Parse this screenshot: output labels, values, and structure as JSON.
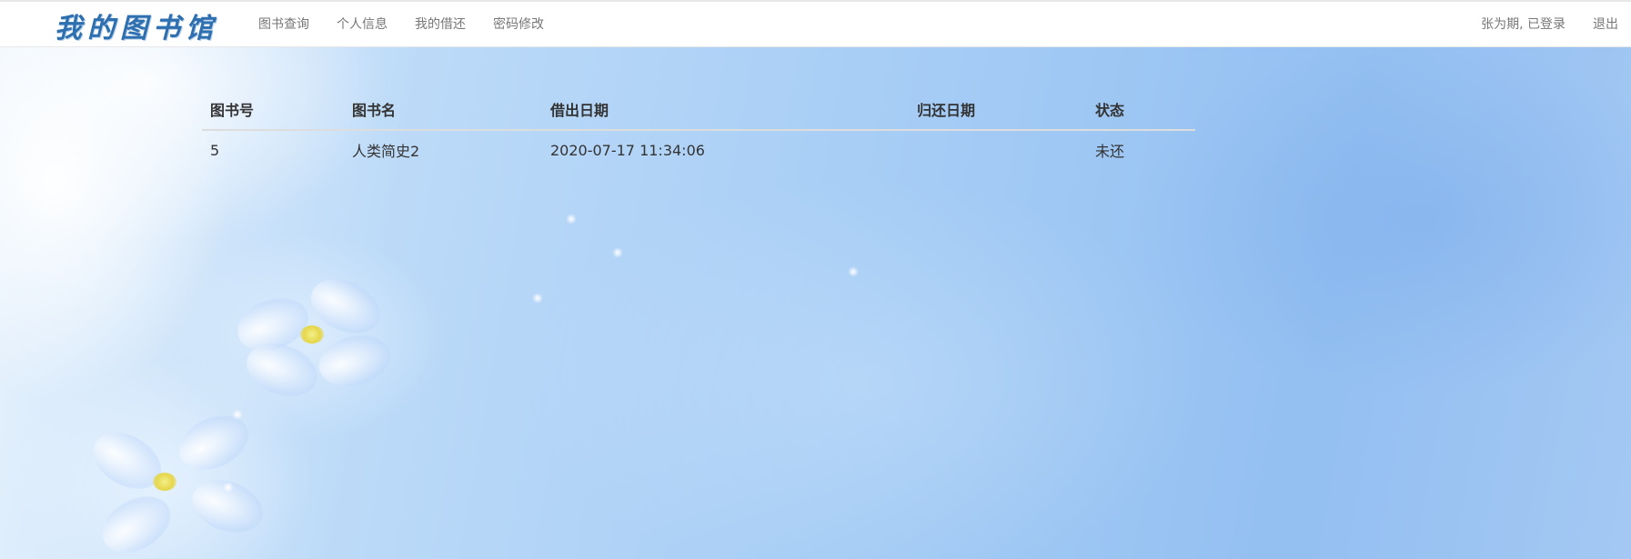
{
  "brand": "我的图书馆",
  "nav": {
    "links": [
      "图书查询",
      "个人信息",
      "我的借还",
      "密码修改"
    ],
    "user_status": "张为期, 已登录",
    "logout": "退出"
  },
  "table": {
    "headers": [
      "图书号",
      "图书名",
      "借出日期",
      "归还日期",
      "状态"
    ],
    "rows": [
      [
        "5",
        "人类简史2",
        "2020-07-17 11:34:06",
        "",
        "未还"
      ]
    ]
  }
}
